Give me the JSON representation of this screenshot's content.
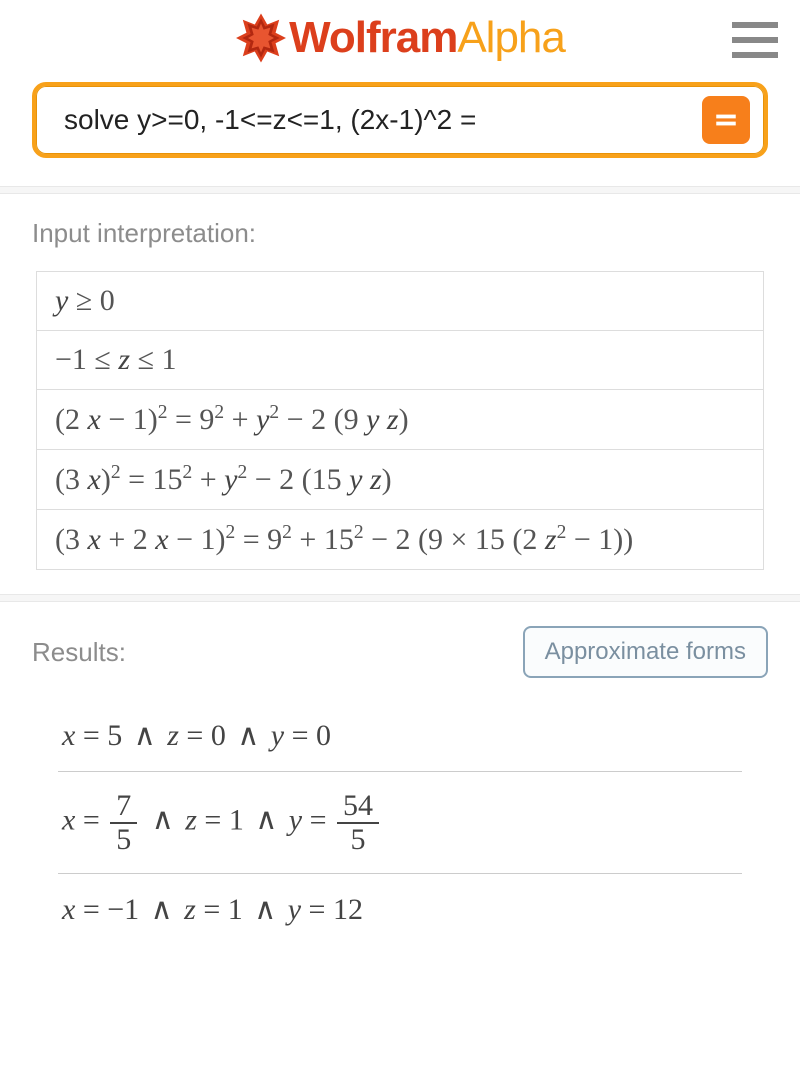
{
  "brand": {
    "name_bold": "Wolfram",
    "name_light": "Alpha",
    "color_primary": "#dc3f1c",
    "color_accent": "#f7a11a"
  },
  "search": {
    "value": "solve y>=0, -1<=z<=1, (2x-1)^2 =",
    "submit_label": "="
  },
  "sections": {
    "input_interpretation": {
      "title": "Input interpretation:",
      "rows": [
        "y ≥ 0",
        "−1 ≤ z ≤ 1",
        "(2 x − 1)² = 9² + y² − 2 (9 y z)",
        "(3 x)² = 15² + y² − 2 (15 y z)",
        "(3 x + 2 x − 1)² = 9² + 15² − 2 (9 × 15 (2 z² − 1))"
      ]
    },
    "results": {
      "title": "Results:",
      "button": "Approximate forms",
      "items": [
        {
          "plain": "x = 5 ∧ z = 0 ∧ y = 0"
        },
        {
          "x_num": "7",
          "x_den": "5",
          "z": "1",
          "y_num": "54",
          "y_den": "5"
        },
        {
          "plain": "x = −1 ∧ z = 1 ∧ y = 12"
        }
      ]
    }
  }
}
